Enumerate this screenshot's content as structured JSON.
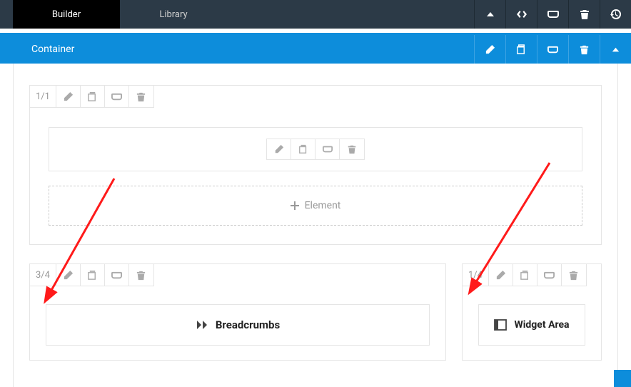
{
  "tabs": {
    "builder": "Builder",
    "library": "Library"
  },
  "container": {
    "title": "Container"
  },
  "panel1": {
    "fraction": "1/1"
  },
  "add_element": {
    "label": "Element"
  },
  "col34": {
    "fraction": "3/4",
    "widget_label": "Breadcrumbs"
  },
  "col14": {
    "fraction": "1/4",
    "widget_label": "Widget Area"
  }
}
